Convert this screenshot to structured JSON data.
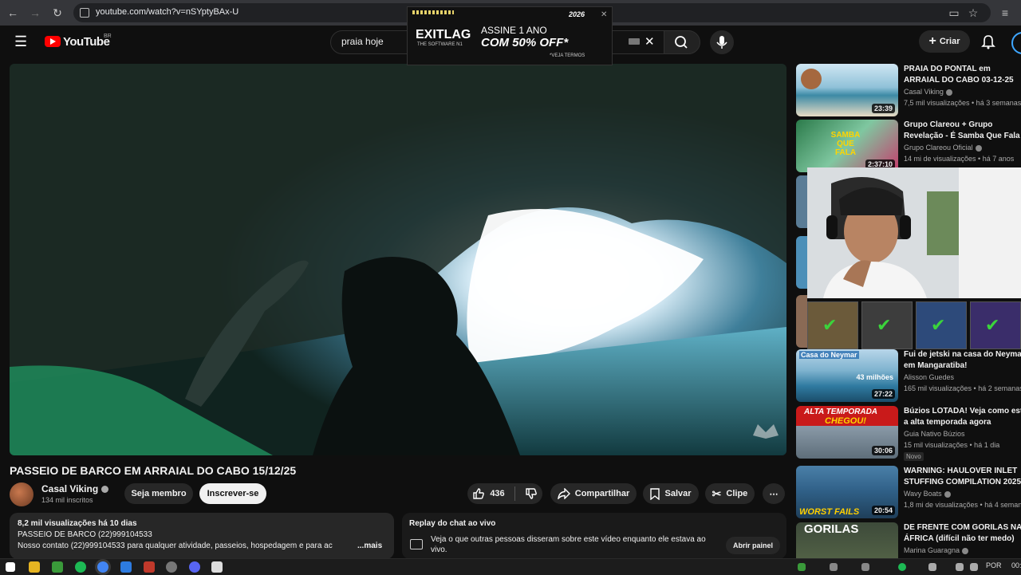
{
  "browser": {
    "url": "youtube.com/watch?v=nSYptyBAx-U"
  },
  "ad": {
    "brand": "EXITLAG",
    "brand_sub": "THE SOFTWARE N1",
    "line1": "ASSINE 1 ANO",
    "line2": "COM 50% OFF*",
    "terms": "*VEJA TERMOS",
    "year": "2026"
  },
  "header": {
    "logo": "YouTube",
    "region": "BR",
    "search_value": "praia hoje",
    "create_label": "Criar"
  },
  "video": {
    "title": "PASSEIO DE BARCO EM ARRAIAL DO CABO 15/12/25",
    "channel": "Casal Viking",
    "subscribers": "134 mil inscritos",
    "join_label": "Seja membro",
    "subscribe_label": "Inscrever-se",
    "likes": "436",
    "share_label": "Compartilhar",
    "save_label": "Salvar",
    "clip_label": "Clipe",
    "watermark": "Casal Viking"
  },
  "description": {
    "meta": "8,2 mil visualizações  há 10 dias",
    "line1": "PASSEIO DE BARCO (22)999104533",
    "line2": "Nosso contato (22)999104533 para qualquer atividade, passeios, hospedagem e para ac",
    "more": "...mais"
  },
  "chat": {
    "title": "Replay do chat ao vivo",
    "text": "Veja o que outras pessoas disseram sobre este vídeo enquanto ele estava ao vivo.",
    "open_label": "Abrir painel"
  },
  "recommendations": [
    {
      "title1": "PRAIA DO PONTAL em",
      "title2": "ARRAIAL DO CABO 03-12-25",
      "channel": "Casal Viking",
      "meta": "7,5 mil visualizações • há 3 semanas",
      "duration": "23:39"
    },
    {
      "title1": "Grupo Clareou + Grupo",
      "title2": "Revelação - É Samba Que Fala",
      "channel": "Grupo Clareou Oficial",
      "meta": "14 mi de visualizações • há 7 anos",
      "duration": "2:37:10",
      "thumb_text": "SAMBA QUE FALA"
    },
    {
      "title1": "Fui de jetski na casa do Neymar",
      "title2": "em Mangaratiba!",
      "channel": "Alisson Guedes",
      "meta": "165 mil visualizações • há 2 semanas",
      "duration": "27:22",
      "thumb_text1": "Casa do Neymar",
      "thumb_text2": "43 milhões"
    },
    {
      "title1": "Búzios LOTADA! Veja como está",
      "title2": "a alta temporada agora",
      "channel": "Guia Nativo Búzios",
      "meta": "15 mil visualizações • há 1 dia",
      "duration": "30:06",
      "badge": "Novo",
      "thumb_text1": "ALTA TEMPORADA",
      "thumb_text2": "CHEGOU!"
    },
    {
      "title1": "WARNING: HAULOVER INLET",
      "title2": "STUFFING COMPILATION 2025",
      "channel": "Wavy Boats",
      "meta": "1,8 mi de visualizações • há 4 semanas",
      "duration": "20:54",
      "thumb_text": "WORST FAILS"
    },
    {
      "title1": "DE FRENTE COM GORILAS NA",
      "title2": "ÁFRICA (difícil não ter medo)",
      "channel": "Marina Guaragna",
      "meta": "",
      "duration": "",
      "thumb_text": "GORILAS"
    }
  ],
  "taskbar": {
    "lang": "POR",
    "time": "00:3"
  }
}
